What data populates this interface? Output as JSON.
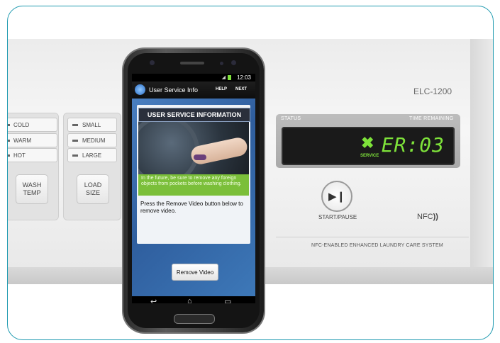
{
  "appliance": {
    "model": "ELC-1200",
    "wash_temp": {
      "options": [
        "COLD",
        "WARM",
        "HOT"
      ],
      "button": "WASH\nTEMP"
    },
    "load_size": {
      "options": [
        "SMALL",
        "MEDIUM",
        "LARGE"
      ],
      "button": "LOAD\nSIZE"
    },
    "status": {
      "status_label": "STATUS",
      "time_label": "TIME REMAINING",
      "error_code": "ER:03",
      "service_label": "SERVICE"
    },
    "start_pause_label": "START/PAUSE",
    "nfc_label": "NFC",
    "tagline": "NFC-ENABLED ENHANCED LAUNDRY CARE SYSTEM"
  },
  "phone": {
    "status_bar": {
      "time": "12:03"
    },
    "action_bar": {
      "title": "User Service Info",
      "help": "HELP",
      "next": "NEXT"
    },
    "card_title": "USER SERVICE INFORMATION",
    "tip_text": "In the future, be sure to remove any foreign objects from pockets before washing clothing.",
    "instruction": "Press the Remove Video button below to remove video.",
    "remove_button": "Remove Video"
  },
  "colors": {
    "frame": "#1f9ab0",
    "display_text": "#7ee23a",
    "tip_background": "#7bbf3a"
  }
}
